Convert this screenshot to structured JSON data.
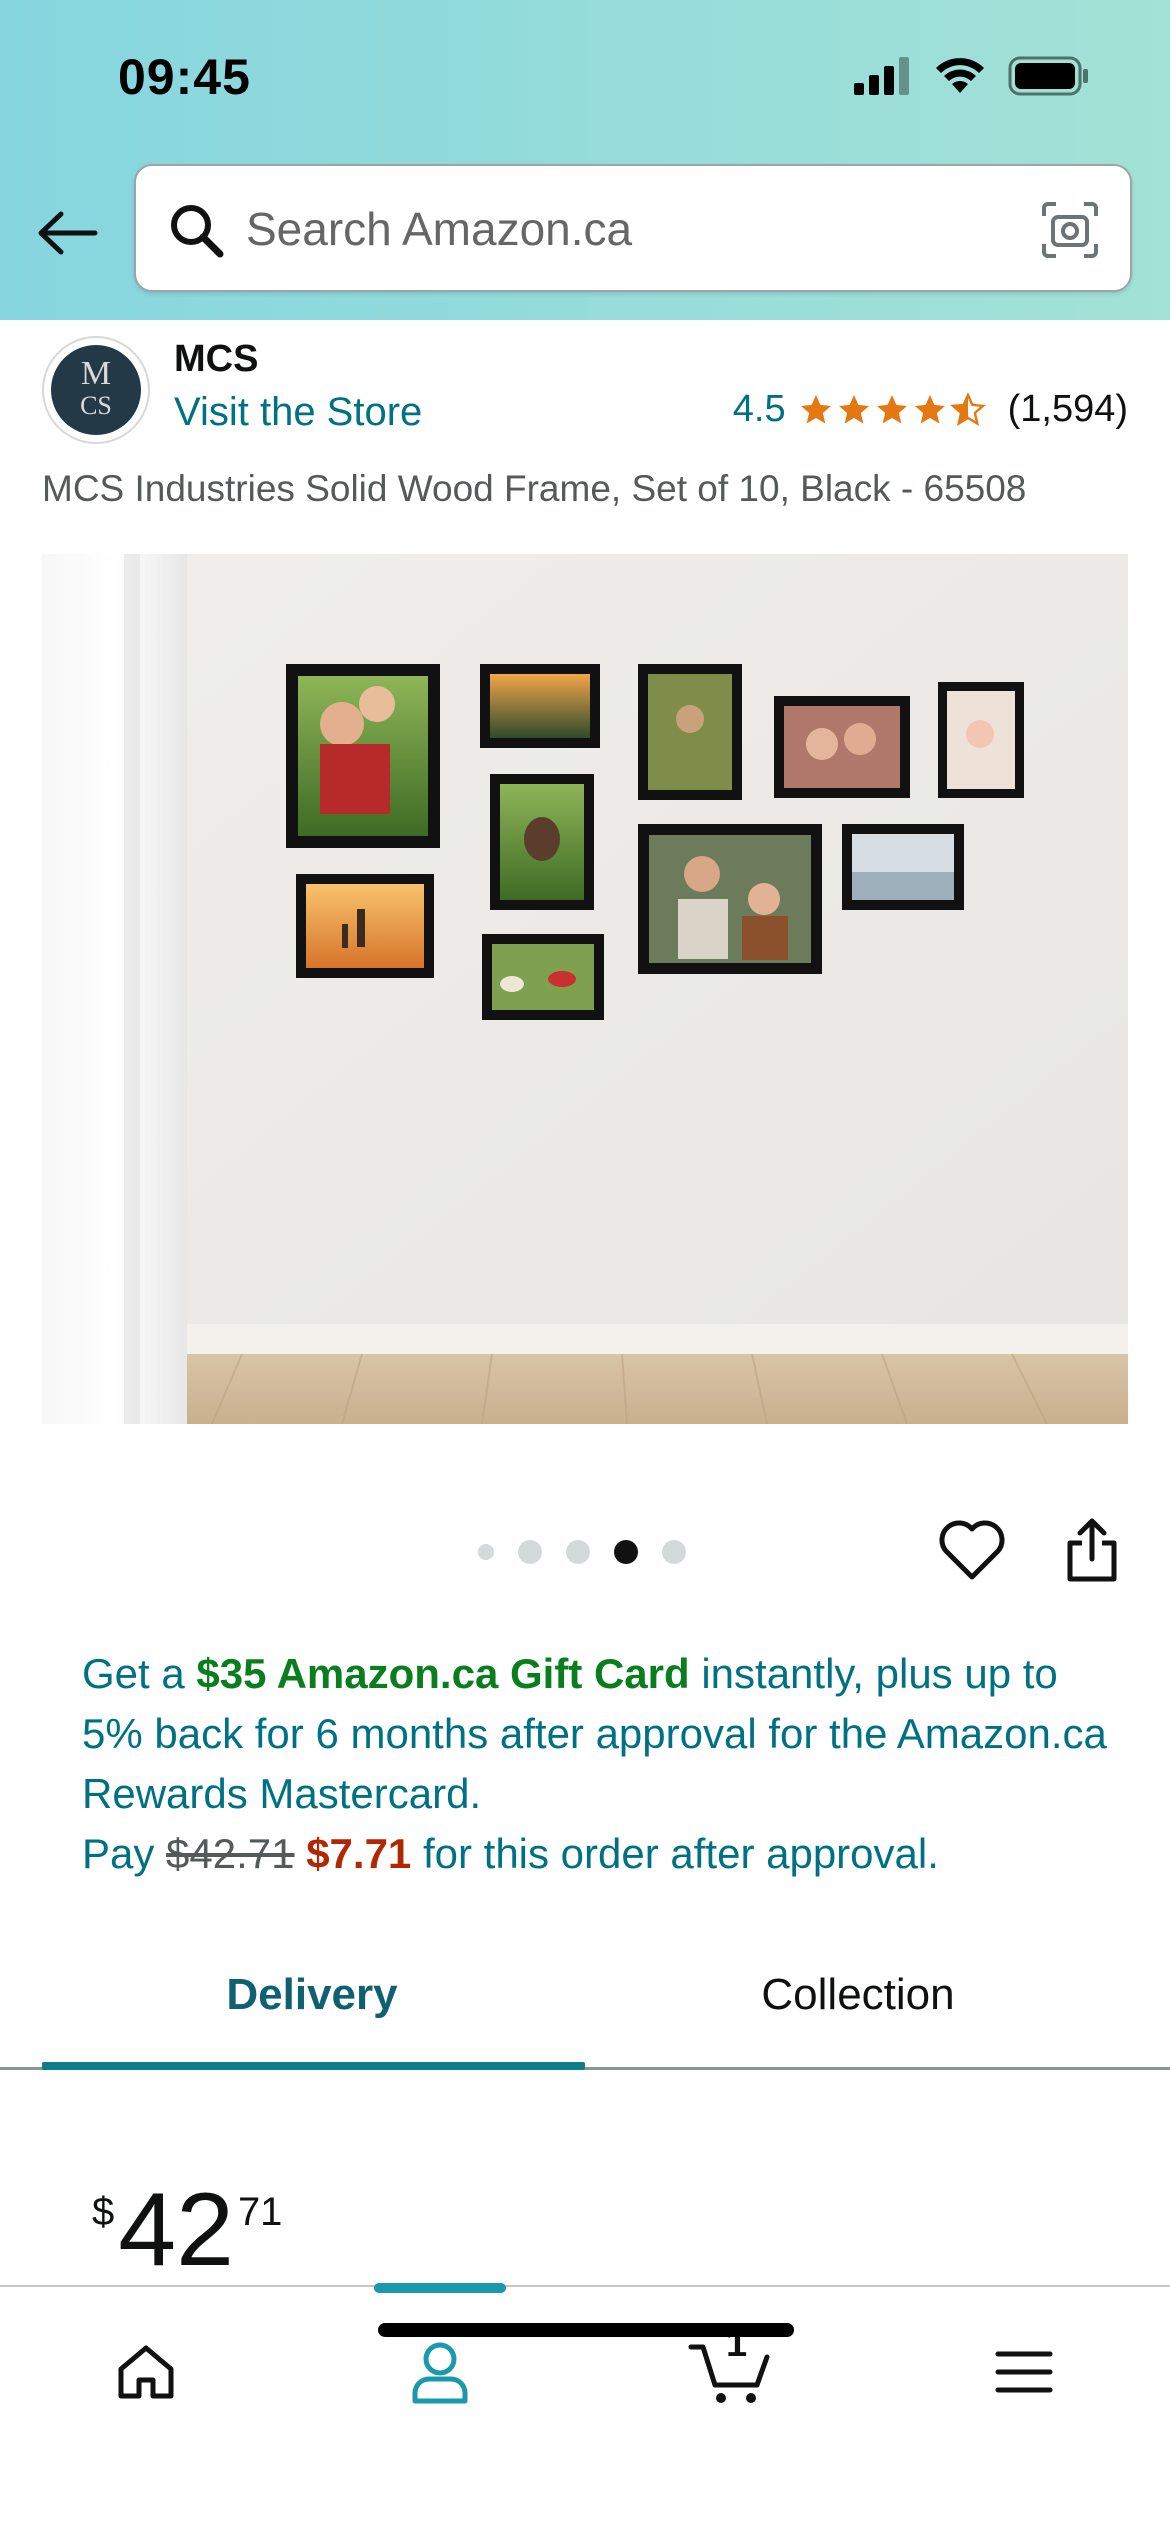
{
  "status_bar": {
    "time": "09:45"
  },
  "header": {
    "search_placeholder": "Search Amazon.ca",
    "colors": {
      "gradient_start": "#86d6df",
      "gradient_end": "#a3e2d6"
    }
  },
  "brand": {
    "name": "MCS",
    "visit_store": "Visit the Store",
    "logo_text_top": "M",
    "logo_text_bottom": "CS"
  },
  "rating": {
    "value": "4.5",
    "stars": 4.5,
    "count": "(1,594)",
    "star_color": "#e47911"
  },
  "product": {
    "title": "MCS Industries Solid Wood Frame, Set of 10, Black - 65508"
  },
  "carousel": {
    "total": 5,
    "active_index": 3
  },
  "promo": {
    "part1": "Get a ",
    "highlight": "$35 Amazon.ca Gift Card",
    "part2": " instantly, plus up to 5% back for 6 months after approval for the Amazon.ca Rewards Mastercard.",
    "pay_label": "Pay ",
    "old_price": "$42.71",
    "new_price": "$7.71",
    "pay_suffix": " for this order after approval."
  },
  "tabs": [
    {
      "label": "Delivery",
      "active": true
    },
    {
      "label": "Collection",
      "active": false
    }
  ],
  "price": {
    "symbol": "$",
    "whole": "42",
    "fraction": "71"
  },
  "bottom_nav": {
    "items": [
      "home-icon",
      "account-icon",
      "cart-icon",
      "menu-icon"
    ],
    "active": "account-icon",
    "cart_count": "1",
    "accent": "#1a98ad"
  }
}
